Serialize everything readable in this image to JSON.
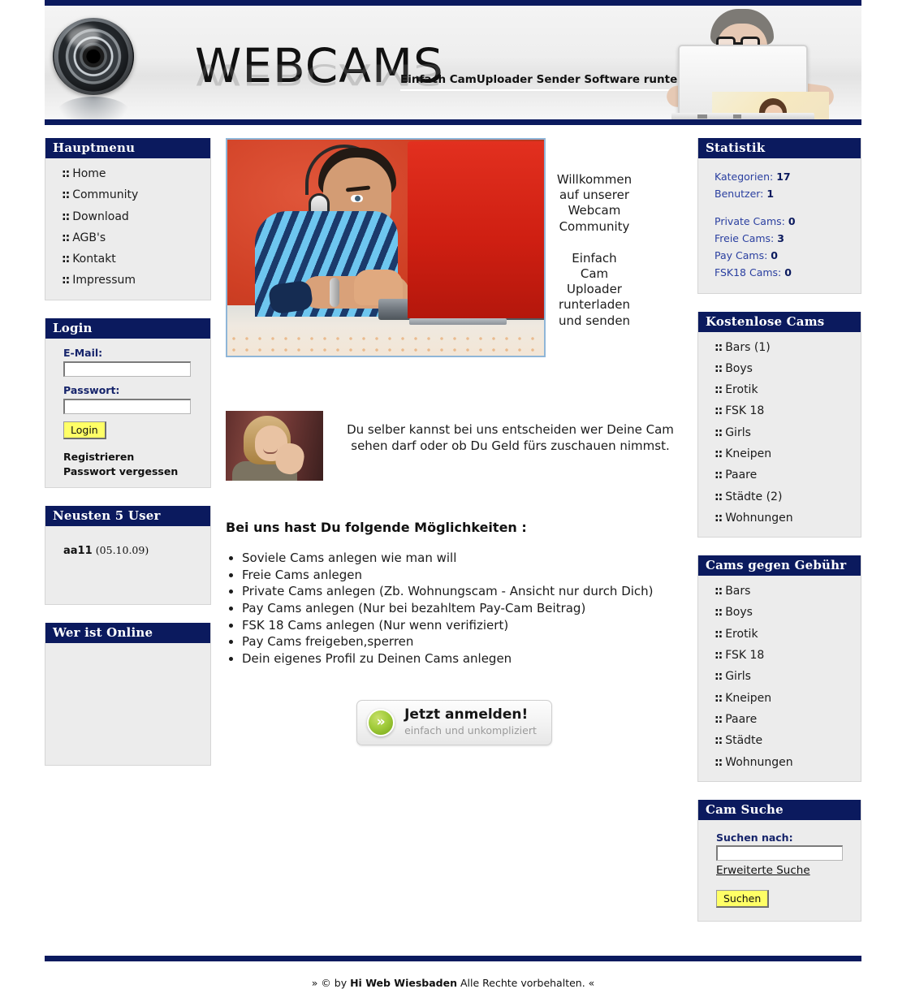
{
  "header": {
    "brand": "WEBCAMS",
    "tagline": "Einfach CamUploader Sender Software runterladen und senden"
  },
  "sidebar_left": {
    "mainmenu": {
      "title": "Hauptmenu",
      "items": [
        {
          "label": "Home"
        },
        {
          "label": "Community"
        },
        {
          "label": "Download"
        },
        {
          "label": "AGB's"
        },
        {
          "label": "Kontakt"
        },
        {
          "label": "Impressum"
        }
      ]
    },
    "login": {
      "title": "Login",
      "email_label": "E-Mail:",
      "email_value": "",
      "password_label": "Passwort:",
      "password_value": "",
      "submit_label": "Login",
      "register_link": "Registrieren",
      "forgot_link": "Passwort vergessen"
    },
    "newest_users": {
      "title": "Neusten 5 User",
      "users": [
        {
          "name": "aa11",
          "date": "(05.10.09)"
        }
      ]
    },
    "who_online": {
      "title": "Wer ist Online",
      "items": []
    }
  },
  "main": {
    "hero_caption_line1": "Willkommen",
    "hero_caption_line2": "auf unserer",
    "hero_caption_line3": "Webcam",
    "hero_caption_line4": "Community",
    "hero_caption_line5": "Einfach",
    "hero_caption_line6": "Cam",
    "hero_caption_line7": "Uploader",
    "hero_caption_line8": "runterladen",
    "hero_caption_line9": "und senden",
    "paragraph": "Du selber kannst bei uns entscheiden wer Deine Cam sehen darf oder ob Du Geld fürs zuschauen nimmst.",
    "features_title": "Bei uns hast Du folgende Möglichkeiten :",
    "features": [
      "Soviele Cams anlegen wie man will",
      "Freie Cams anlegen",
      "Private Cams anlegen (Zb. Wohnungscam - Ansicht nur durch Dich)",
      "Pay Cams anlegen (Nur bei bezahltem Pay-Cam Beitrag)",
      "FSK 18 Cams anlegen (Nur wenn verifiziert)",
      "Pay Cams freigeben,sperren",
      "Dein eigenes Profil zu Deinen Cams anlegen"
    ],
    "signup": {
      "main_label": "Jetzt anmelden!",
      "sub_label": "einfach und unkompliziert",
      "icon": "double-chevron-right"
    }
  },
  "sidebar_right": {
    "statistik": {
      "title": "Statistik",
      "rows_top": [
        {
          "label": "Kategorien:",
          "value": "17"
        },
        {
          "label": "Benutzer:",
          "value": "1"
        }
      ],
      "rows_bottom": [
        {
          "label": "Private Cams:",
          "value": "0"
        },
        {
          "label": "Freie Cams:",
          "value": "3"
        },
        {
          "label": "Pay Cams:",
          "value": "0"
        },
        {
          "label": "FSK18 Cams:",
          "value": "0"
        }
      ]
    },
    "free_cams": {
      "title": "Kostenlose Cams",
      "items": [
        {
          "label": "Bars (1)"
        },
        {
          "label": "Boys"
        },
        {
          "label": "Erotik"
        },
        {
          "label": "FSK 18"
        },
        {
          "label": "Girls"
        },
        {
          "label": "Kneipen"
        },
        {
          "label": "Paare"
        },
        {
          "label": "Städte (2)"
        },
        {
          "label": "Wohnungen"
        }
      ]
    },
    "paid_cams": {
      "title": "Cams gegen Gebühr",
      "items": [
        {
          "label": "Bars"
        },
        {
          "label": "Boys"
        },
        {
          "label": "Erotik"
        },
        {
          "label": "FSK 18"
        },
        {
          "label": "Girls"
        },
        {
          "label": "Kneipen"
        },
        {
          "label": "Paare"
        },
        {
          "label": "Städte"
        },
        {
          "label": "Wohnungen"
        }
      ]
    },
    "cam_search": {
      "title": "Cam Suche",
      "label": "Suchen nach:",
      "value": "",
      "advanced_link": "Erweiterte Suche",
      "submit_label": "Suchen"
    }
  },
  "footer": {
    "prefix": "» © by ",
    "brand": "Hi Web Wiesbaden",
    "suffix": " Alle Rechte vorbehalten. «"
  },
  "colors": {
    "navy": "#0b1a5e",
    "panel_bg": "#ececec",
    "accent_yellow": "#ffff66",
    "stat_blue": "#2a3fa0",
    "green": "#a2cc3c"
  },
  "bullet_marker": "::"
}
